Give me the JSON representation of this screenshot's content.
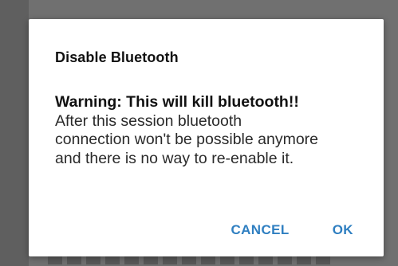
{
  "dialog": {
    "title": "Disable Bluetooth",
    "warning": "Warning: This will kill bluetooth!!",
    "message": "After this session bluetooth\nconnection won't be possible anymore\nand there is no way to re-enable it.",
    "cancel_label": "CANCEL",
    "ok_label": "OK"
  },
  "colors": {
    "button_text": "#2f7fc1",
    "overlay": "#707070"
  }
}
